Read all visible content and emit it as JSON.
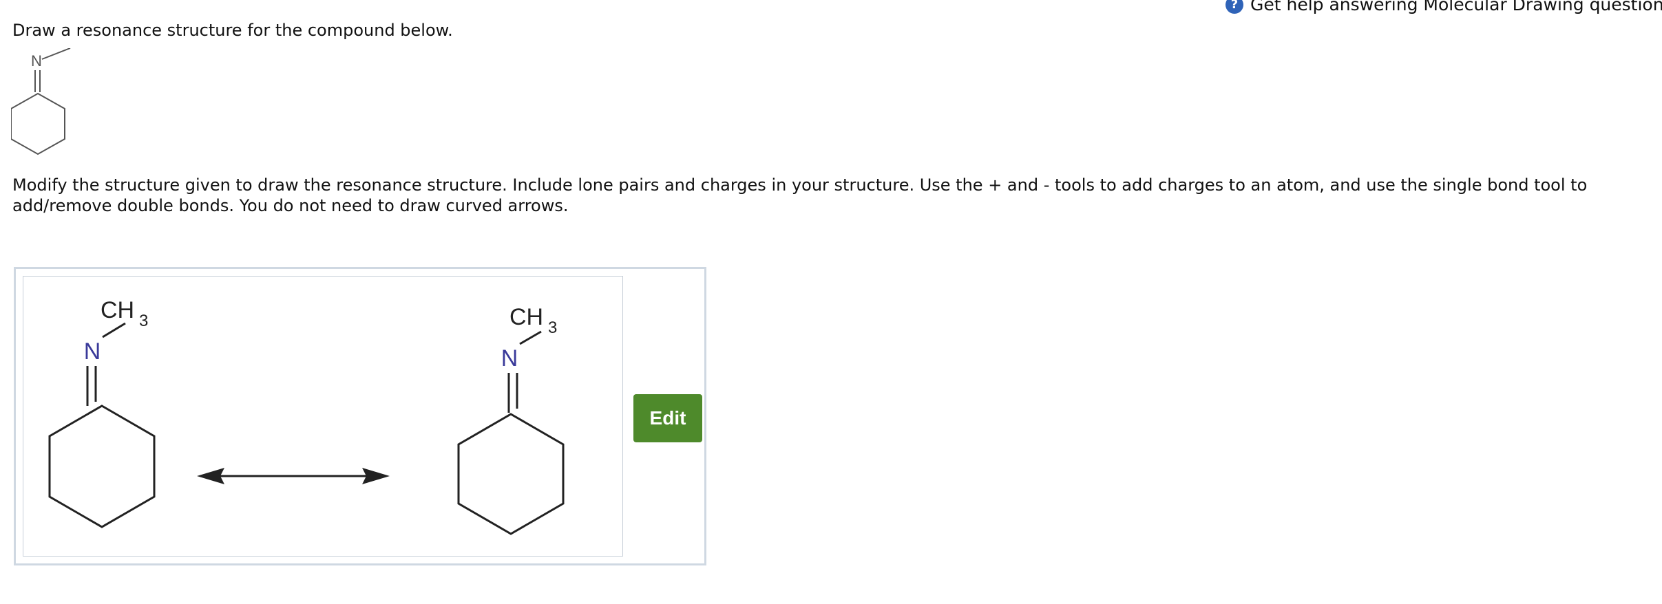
{
  "help": {
    "label": "Get help answering Molecular Drawing questions."
  },
  "question": {
    "text": "Draw a resonance structure for the compound below."
  },
  "instructions": {
    "text": "Modify the structure given to draw the resonance structure. Include lone pairs and charges in your structure. Use the + and - tools to add charges to an atom, and use the single bond tool to add/remove double bonds. You do not need to draw curved arrows."
  },
  "small_structure": {
    "nitrogen_label": "N"
  },
  "answer_panel": {
    "structure_left": {
      "nitrogen_label": "N",
      "methyl_label": "CH",
      "methyl_subscript": "3"
    },
    "structure_right": {
      "nitrogen_label": "N",
      "methyl_label": "CH",
      "methyl_subscript": "3"
    },
    "edit_label": "Edit"
  },
  "colors": {
    "edit_button": "#4e8a2b",
    "help_icon": "#2f63b8",
    "nitrogen": "#3a3a9a"
  }
}
